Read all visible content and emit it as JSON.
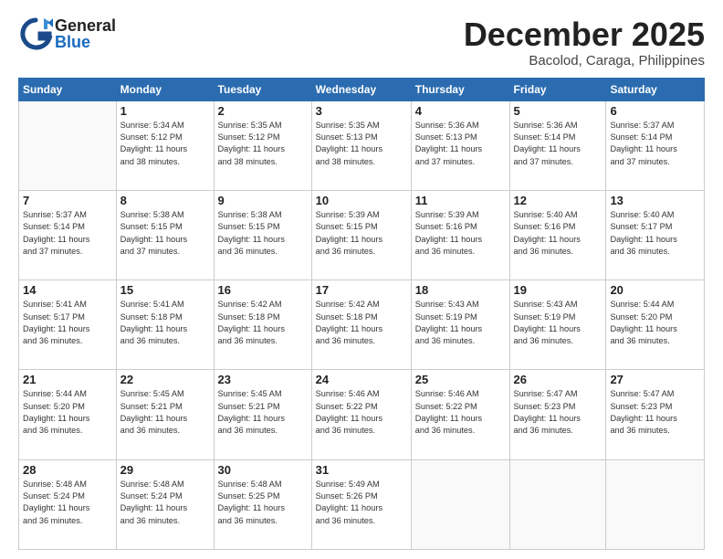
{
  "logo": {
    "general": "General",
    "blue": "Blue"
  },
  "title": "December 2025",
  "location": "Bacolod, Caraga, Philippines",
  "weekdays": [
    "Sunday",
    "Monday",
    "Tuesday",
    "Wednesday",
    "Thursday",
    "Friday",
    "Saturday"
  ],
  "weeks": [
    [
      {
        "day": "",
        "info": ""
      },
      {
        "day": "1",
        "info": "Sunrise: 5:34 AM\nSunset: 5:12 PM\nDaylight: 11 hours\nand 38 minutes."
      },
      {
        "day": "2",
        "info": "Sunrise: 5:35 AM\nSunset: 5:12 PM\nDaylight: 11 hours\nand 38 minutes."
      },
      {
        "day": "3",
        "info": "Sunrise: 5:35 AM\nSunset: 5:13 PM\nDaylight: 11 hours\nand 38 minutes."
      },
      {
        "day": "4",
        "info": "Sunrise: 5:36 AM\nSunset: 5:13 PM\nDaylight: 11 hours\nand 37 minutes."
      },
      {
        "day": "5",
        "info": "Sunrise: 5:36 AM\nSunset: 5:14 PM\nDaylight: 11 hours\nand 37 minutes."
      },
      {
        "day": "6",
        "info": "Sunrise: 5:37 AM\nSunset: 5:14 PM\nDaylight: 11 hours\nand 37 minutes."
      }
    ],
    [
      {
        "day": "7",
        "info": "Sunrise: 5:37 AM\nSunset: 5:14 PM\nDaylight: 11 hours\nand 37 minutes."
      },
      {
        "day": "8",
        "info": "Sunrise: 5:38 AM\nSunset: 5:15 PM\nDaylight: 11 hours\nand 37 minutes."
      },
      {
        "day": "9",
        "info": "Sunrise: 5:38 AM\nSunset: 5:15 PM\nDaylight: 11 hours\nand 36 minutes."
      },
      {
        "day": "10",
        "info": "Sunrise: 5:39 AM\nSunset: 5:15 PM\nDaylight: 11 hours\nand 36 minutes."
      },
      {
        "day": "11",
        "info": "Sunrise: 5:39 AM\nSunset: 5:16 PM\nDaylight: 11 hours\nand 36 minutes."
      },
      {
        "day": "12",
        "info": "Sunrise: 5:40 AM\nSunset: 5:16 PM\nDaylight: 11 hours\nand 36 minutes."
      },
      {
        "day": "13",
        "info": "Sunrise: 5:40 AM\nSunset: 5:17 PM\nDaylight: 11 hours\nand 36 minutes."
      }
    ],
    [
      {
        "day": "14",
        "info": "Sunrise: 5:41 AM\nSunset: 5:17 PM\nDaylight: 11 hours\nand 36 minutes."
      },
      {
        "day": "15",
        "info": "Sunrise: 5:41 AM\nSunset: 5:18 PM\nDaylight: 11 hours\nand 36 minutes."
      },
      {
        "day": "16",
        "info": "Sunrise: 5:42 AM\nSunset: 5:18 PM\nDaylight: 11 hours\nand 36 minutes."
      },
      {
        "day": "17",
        "info": "Sunrise: 5:42 AM\nSunset: 5:18 PM\nDaylight: 11 hours\nand 36 minutes."
      },
      {
        "day": "18",
        "info": "Sunrise: 5:43 AM\nSunset: 5:19 PM\nDaylight: 11 hours\nand 36 minutes."
      },
      {
        "day": "19",
        "info": "Sunrise: 5:43 AM\nSunset: 5:19 PM\nDaylight: 11 hours\nand 36 minutes."
      },
      {
        "day": "20",
        "info": "Sunrise: 5:44 AM\nSunset: 5:20 PM\nDaylight: 11 hours\nand 36 minutes."
      }
    ],
    [
      {
        "day": "21",
        "info": "Sunrise: 5:44 AM\nSunset: 5:20 PM\nDaylight: 11 hours\nand 36 minutes."
      },
      {
        "day": "22",
        "info": "Sunrise: 5:45 AM\nSunset: 5:21 PM\nDaylight: 11 hours\nand 36 minutes."
      },
      {
        "day": "23",
        "info": "Sunrise: 5:45 AM\nSunset: 5:21 PM\nDaylight: 11 hours\nand 36 minutes."
      },
      {
        "day": "24",
        "info": "Sunrise: 5:46 AM\nSunset: 5:22 PM\nDaylight: 11 hours\nand 36 minutes."
      },
      {
        "day": "25",
        "info": "Sunrise: 5:46 AM\nSunset: 5:22 PM\nDaylight: 11 hours\nand 36 minutes."
      },
      {
        "day": "26",
        "info": "Sunrise: 5:47 AM\nSunset: 5:23 PM\nDaylight: 11 hours\nand 36 minutes."
      },
      {
        "day": "27",
        "info": "Sunrise: 5:47 AM\nSunset: 5:23 PM\nDaylight: 11 hours\nand 36 minutes."
      }
    ],
    [
      {
        "day": "28",
        "info": "Sunrise: 5:48 AM\nSunset: 5:24 PM\nDaylight: 11 hours\nand 36 minutes."
      },
      {
        "day": "29",
        "info": "Sunrise: 5:48 AM\nSunset: 5:24 PM\nDaylight: 11 hours\nand 36 minutes."
      },
      {
        "day": "30",
        "info": "Sunrise: 5:48 AM\nSunset: 5:25 PM\nDaylight: 11 hours\nand 36 minutes."
      },
      {
        "day": "31",
        "info": "Sunrise: 5:49 AM\nSunset: 5:26 PM\nDaylight: 11 hours\nand 36 minutes."
      },
      {
        "day": "",
        "info": ""
      },
      {
        "day": "",
        "info": ""
      },
      {
        "day": "",
        "info": ""
      }
    ]
  ]
}
